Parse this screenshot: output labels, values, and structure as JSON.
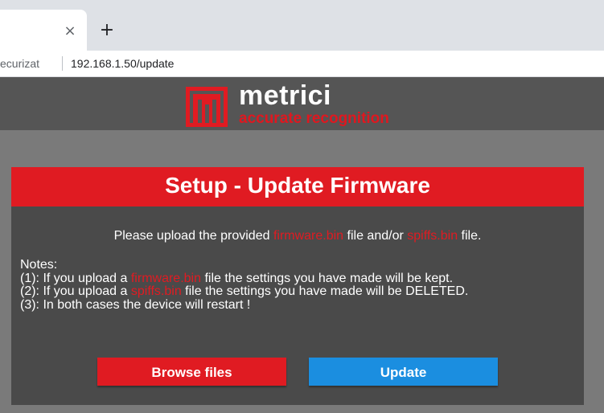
{
  "browser": {
    "tab_close_glyph": "×",
    "new_tab_glyph": "+",
    "security_label": "ecurizat",
    "url": "192.168.1.50/update"
  },
  "header": {
    "brand_name": "metrici",
    "tagline": "accurate recognition"
  },
  "panel": {
    "title": "Setup - Update Firmware",
    "intro": {
      "before": "Please upload the provided ",
      "file1": "firmware.bin",
      "middle": " file and/or ",
      "file2": "spiffs.bin",
      "after": " file."
    },
    "notes_heading": "Notes:",
    "note1": {
      "before": "(1): If you upload a ",
      "file": "firmware.bin",
      "after": " file the settings you have made will be kept."
    },
    "note2": {
      "before": "(2): If you upload a ",
      "file": "spiffs.bin",
      "after": " file the settings you have made will be DELETED."
    },
    "note3": "(3): In both cases the device will restart !"
  },
  "buttons": {
    "browse": "Browse files",
    "update": "Update"
  },
  "colors": {
    "accent_red": "#e01b22",
    "accent_blue": "#1b8ee0",
    "panel_bg": "#4a4a4a"
  }
}
